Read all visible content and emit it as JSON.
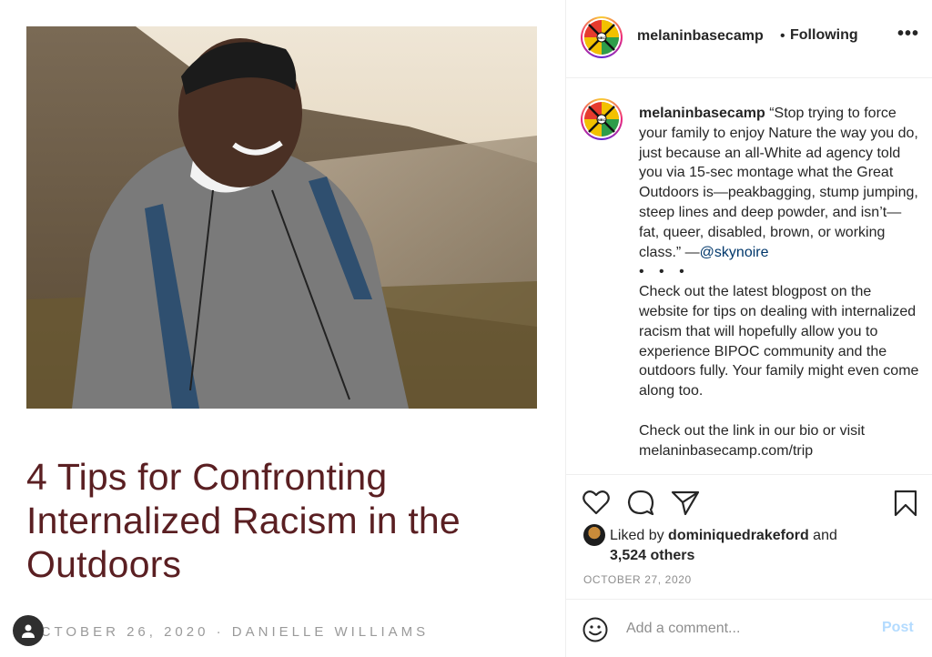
{
  "blog": {
    "title": "4 Tips for Confronting Internalized Racism in the Outdoors",
    "meta": "OCTOBER 26, 2020 · DANIELLE WILLIAMS"
  },
  "post": {
    "username": "melaninbasecamp",
    "follow_separator": "•",
    "follow_status": "Following",
    "more_label": "•••",
    "avatar_badge": "MBC",
    "caption": {
      "username": "melaninbasecamp",
      "quote": "“Stop trying to force your family to enjoy Nature the way you do, just because an all-White ad agency told you via 15-sec montage what the Great Outdoors is—peakbagging, stump jumping, steep lines and deep powder, and isn’t—fat, queer, disabled, brown, or working class.” —",
      "mention": "@skynoire",
      "dots": "• • •",
      "paragraph2": "Check out the latest blogpost on the website for tips on dealing with internalized racism that will hopefully allow you to experience BIPOC community and the outdoors fully. Your family might even come along too.",
      "paragraph3": "Check out the link in our bio or visit melaninbasecamp.com/trip"
    },
    "likes": {
      "prefix": "Liked by ",
      "user": "dominiquedrakeford",
      "joiner": " and",
      "others": "3,524 others"
    },
    "date": "OCTOBER 27, 2020",
    "comment": {
      "placeholder": "Add a comment...",
      "post_label": "Post"
    }
  },
  "colors": {
    "title_maroon": "#5a1f22",
    "mention_blue": "#00376b",
    "post_disabled": "#b3dbff",
    "meta_gray": "#8e8e8e"
  },
  "icons": [
    "heart-icon",
    "comment-icon",
    "share-icon",
    "bookmark-icon",
    "emoji-icon",
    "user-icon",
    "more-icon"
  ]
}
